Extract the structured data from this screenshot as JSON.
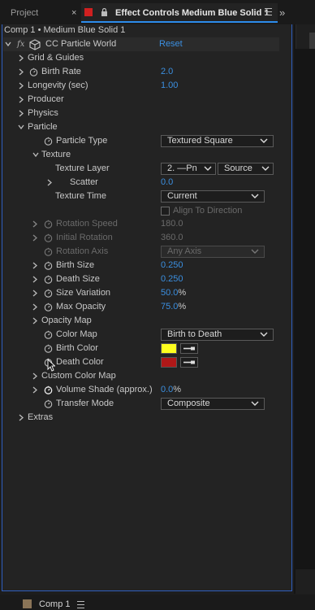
{
  "tabs": {
    "project": "Project",
    "close": "×",
    "effect_controls": "Effect Controls Medium Blue Solid 1",
    "overflow": "»"
  },
  "breadcrumb": "Comp 1 • Medium Blue Solid 1",
  "effect": {
    "fx": "fx",
    "name": "CC Particle World",
    "reset": "Reset"
  },
  "params": {
    "grid_guides": "Grid & Guides",
    "birth_rate": {
      "label": "Birth Rate",
      "value": "2.0"
    },
    "longevity": {
      "label": "Longevity (sec)",
      "value": "1.00"
    },
    "producer": "Producer",
    "physics": "Physics",
    "particle": "Particle",
    "particle_type": {
      "label": "Particle Type",
      "value": "Textured Square"
    },
    "texture": "Texture",
    "texture_layer": {
      "label": "Texture Layer",
      "layer_value": "2. —Pn",
      "source_value": "Source"
    },
    "scatter": {
      "label": "Scatter",
      "value": "0.0"
    },
    "texture_time": {
      "label": "Texture Time",
      "value": "Current"
    },
    "align_direction": "Align To Direction",
    "rotation_speed": {
      "label": "Rotation Speed",
      "value": "180.0"
    },
    "initial_rotation": {
      "label": "Initial Rotation",
      "value": "360.0"
    },
    "rotation_axis": {
      "label": "Rotation Axis",
      "value": "Any Axis"
    },
    "birth_size": {
      "label": "Birth Size",
      "value": "0.250"
    },
    "death_size": {
      "label": "Death Size",
      "value": "0.250"
    },
    "size_variation": {
      "label": "Size Variation",
      "value": "50.0",
      "unit": "%"
    },
    "max_opacity": {
      "label": "Max Opacity",
      "value": "75.0",
      "unit": "%"
    },
    "opacity_map": "Opacity Map",
    "color_map": {
      "label": "Color Map",
      "value": "Birth to Death"
    },
    "birth_color": {
      "label": "Birth Color",
      "color": "#ffff1e"
    },
    "death_color": {
      "label": "Death Color",
      "color": "#b01818"
    },
    "custom_color_map": "Custom Color Map",
    "volume_shade": {
      "label": "Volume Shade (approx.)",
      "value": "0.0",
      "unit": "%"
    },
    "transfer_mode": {
      "label": "Transfer Mode",
      "value": "Composite"
    },
    "extras": "Extras"
  },
  "bottom": {
    "comp_tab": "Comp 1"
  },
  "colors": {
    "accent_blue": "#3b8fe0",
    "panel_border": "#2f5fbf",
    "tab_red": "#d02020"
  }
}
